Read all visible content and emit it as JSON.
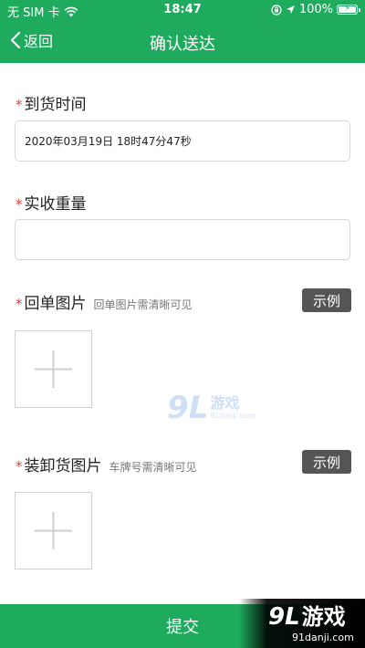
{
  "status_bar": {
    "carrier": "无 SIM 卡",
    "time": "18:47",
    "battery": "100%",
    "battery_level": 1.0
  },
  "nav": {
    "back_label": "返回",
    "title": "确认送达"
  },
  "form": {
    "required_mark": "*",
    "arrival_time": {
      "label": "到货时间",
      "value": "2020年03月19日 18时47分47秒"
    },
    "received_weight": {
      "label": "实收重量",
      "value": ""
    },
    "receipt_photo": {
      "label": "回单图片",
      "hint": "回单图片需清晰可见",
      "example_label": "示例"
    },
    "loading_photo": {
      "label": "装卸货图片",
      "hint": "车牌号需清晰可见",
      "example_label": "示例"
    }
  },
  "submit_label": "提交",
  "watermark": {
    "big": "9L",
    "cn": "游戏",
    "url": "91danji.com"
  },
  "corner_logo": {
    "big": "9L",
    "cn": "游戏",
    "url": "91danji.com"
  },
  "colors": {
    "brand_green": "#1fab5e",
    "required_red": "#e23c3c",
    "example_button": "#555555"
  },
  "icons": {
    "wifi": "wifi-icon",
    "lock_rotation": "rotation-lock-icon",
    "location": "location-arrow-icon",
    "back": "chevron-left-icon",
    "add": "plus-icon"
  }
}
